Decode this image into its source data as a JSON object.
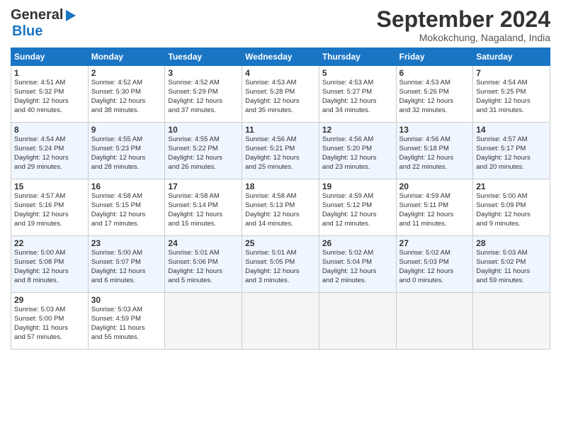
{
  "header": {
    "logo_line1": "General",
    "logo_line2": "Blue",
    "month": "September 2024",
    "location": "Mokokchung, Nagaland, India"
  },
  "weekdays": [
    "Sunday",
    "Monday",
    "Tuesday",
    "Wednesday",
    "Thursday",
    "Friday",
    "Saturday"
  ],
  "weeks": [
    [
      {
        "day": "1",
        "info": "Sunrise: 4:51 AM\nSunset: 5:32 PM\nDaylight: 12 hours\nand 40 minutes."
      },
      {
        "day": "2",
        "info": "Sunrise: 4:52 AM\nSunset: 5:30 PM\nDaylight: 12 hours\nand 38 minutes."
      },
      {
        "day": "3",
        "info": "Sunrise: 4:52 AM\nSunset: 5:29 PM\nDaylight: 12 hours\nand 37 minutes."
      },
      {
        "day": "4",
        "info": "Sunrise: 4:53 AM\nSunset: 5:28 PM\nDaylight: 12 hours\nand 35 minutes."
      },
      {
        "day": "5",
        "info": "Sunrise: 4:53 AM\nSunset: 5:27 PM\nDaylight: 12 hours\nand 34 minutes."
      },
      {
        "day": "6",
        "info": "Sunrise: 4:53 AM\nSunset: 5:26 PM\nDaylight: 12 hours\nand 32 minutes."
      },
      {
        "day": "7",
        "info": "Sunrise: 4:54 AM\nSunset: 5:25 PM\nDaylight: 12 hours\nand 31 minutes."
      }
    ],
    [
      {
        "day": "8",
        "info": "Sunrise: 4:54 AM\nSunset: 5:24 PM\nDaylight: 12 hours\nand 29 minutes."
      },
      {
        "day": "9",
        "info": "Sunrise: 4:55 AM\nSunset: 5:23 PM\nDaylight: 12 hours\nand 28 minutes."
      },
      {
        "day": "10",
        "info": "Sunrise: 4:55 AM\nSunset: 5:22 PM\nDaylight: 12 hours\nand 26 minutes."
      },
      {
        "day": "11",
        "info": "Sunrise: 4:56 AM\nSunset: 5:21 PM\nDaylight: 12 hours\nand 25 minutes."
      },
      {
        "day": "12",
        "info": "Sunrise: 4:56 AM\nSunset: 5:20 PM\nDaylight: 12 hours\nand 23 minutes."
      },
      {
        "day": "13",
        "info": "Sunrise: 4:56 AM\nSunset: 5:18 PM\nDaylight: 12 hours\nand 22 minutes."
      },
      {
        "day": "14",
        "info": "Sunrise: 4:57 AM\nSunset: 5:17 PM\nDaylight: 12 hours\nand 20 minutes."
      }
    ],
    [
      {
        "day": "15",
        "info": "Sunrise: 4:57 AM\nSunset: 5:16 PM\nDaylight: 12 hours\nand 19 minutes."
      },
      {
        "day": "16",
        "info": "Sunrise: 4:58 AM\nSunset: 5:15 PM\nDaylight: 12 hours\nand 17 minutes."
      },
      {
        "day": "17",
        "info": "Sunrise: 4:58 AM\nSunset: 5:14 PM\nDaylight: 12 hours\nand 15 minutes."
      },
      {
        "day": "18",
        "info": "Sunrise: 4:58 AM\nSunset: 5:13 PM\nDaylight: 12 hours\nand 14 minutes."
      },
      {
        "day": "19",
        "info": "Sunrise: 4:59 AM\nSunset: 5:12 PM\nDaylight: 12 hours\nand 12 minutes."
      },
      {
        "day": "20",
        "info": "Sunrise: 4:59 AM\nSunset: 5:11 PM\nDaylight: 12 hours\nand 11 minutes."
      },
      {
        "day": "21",
        "info": "Sunrise: 5:00 AM\nSunset: 5:09 PM\nDaylight: 12 hours\nand 9 minutes."
      }
    ],
    [
      {
        "day": "22",
        "info": "Sunrise: 5:00 AM\nSunset: 5:08 PM\nDaylight: 12 hours\nand 8 minutes."
      },
      {
        "day": "23",
        "info": "Sunrise: 5:00 AM\nSunset: 5:07 PM\nDaylight: 12 hours\nand 6 minutes."
      },
      {
        "day": "24",
        "info": "Sunrise: 5:01 AM\nSunset: 5:06 PM\nDaylight: 12 hours\nand 5 minutes."
      },
      {
        "day": "25",
        "info": "Sunrise: 5:01 AM\nSunset: 5:05 PM\nDaylight: 12 hours\nand 3 minutes."
      },
      {
        "day": "26",
        "info": "Sunrise: 5:02 AM\nSunset: 5:04 PM\nDaylight: 12 hours\nand 2 minutes."
      },
      {
        "day": "27",
        "info": "Sunrise: 5:02 AM\nSunset: 5:03 PM\nDaylight: 12 hours\nand 0 minutes."
      },
      {
        "day": "28",
        "info": "Sunrise: 5:03 AM\nSunset: 5:02 PM\nDaylight: 11 hours\nand 59 minutes."
      }
    ],
    [
      {
        "day": "29",
        "info": "Sunrise: 5:03 AM\nSunset: 5:00 PM\nDaylight: 11 hours\nand 57 minutes."
      },
      {
        "day": "30",
        "info": "Sunrise: 5:03 AM\nSunset: 4:59 PM\nDaylight: 11 hours\nand 55 minutes."
      },
      {
        "day": "",
        "info": ""
      },
      {
        "day": "",
        "info": ""
      },
      {
        "day": "",
        "info": ""
      },
      {
        "day": "",
        "info": ""
      },
      {
        "day": "",
        "info": ""
      }
    ]
  ]
}
